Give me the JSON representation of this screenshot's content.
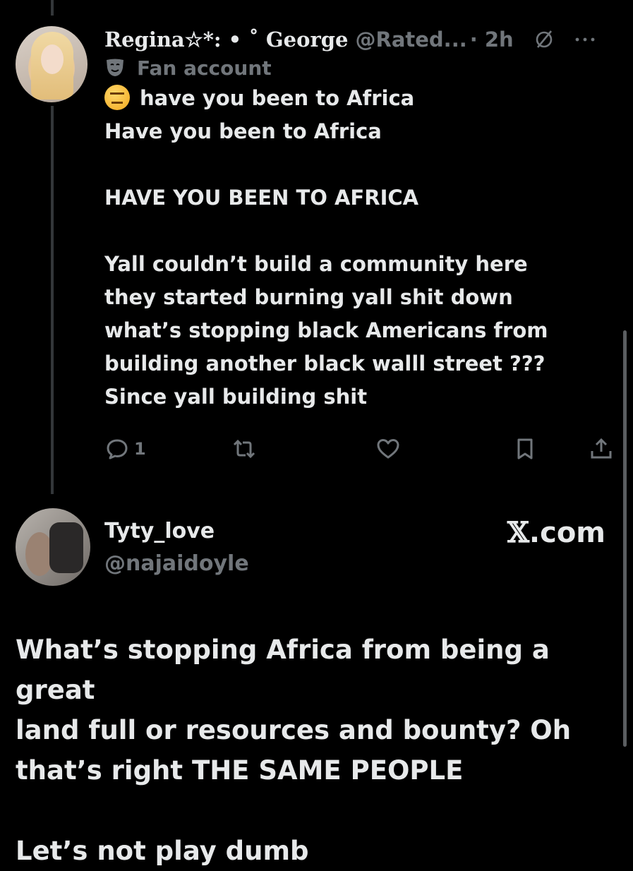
{
  "tweet1": {
    "display_name": "Regina☆*: • ˚ George",
    "handle": "@Rated...",
    "time": "· 2h",
    "label": "Fan account",
    "lines": [
      "have you been to Africa",
      "Have you been to Africa",
      "",
      "HAVE YOU BEEN TO AFRICA",
      "",
      "Yall couldn’t build a community here",
      "they started burning yall shit down",
      "what’s stopping black Americans from",
      "building another black walll street ???",
      "Since yall building shit"
    ],
    "reply_count": "1",
    "icons": {
      "emoji": "raised-eyebrow-emoji",
      "label_icon": "theater-mask-icon",
      "no_entry": "null-circle-icon",
      "more": "more-dots-icon",
      "reply": "reply-icon",
      "retweet": "retweet-icon",
      "like": "heart-icon",
      "bookmark": "bookmark-icon",
      "share": "share-icon"
    }
  },
  "tweet2": {
    "display_name": "Tyty_love",
    "handle": "@najaidoyle",
    "watermark": "𝕏.com",
    "watermark_x": "𝕏",
    "watermark_rest": ".com",
    "lines": [
      "What’s stopping Africa from being a great",
      "land full or resources and bounty? Oh",
      "that’s right THE SAME PEOPLE",
      "",
      "Let’s not play dumb"
    ]
  },
  "colors": {
    "background": "#000000",
    "text_primary": "#e7e9ea",
    "text_secondary": "#71767b",
    "thread_line": "#333639"
  }
}
